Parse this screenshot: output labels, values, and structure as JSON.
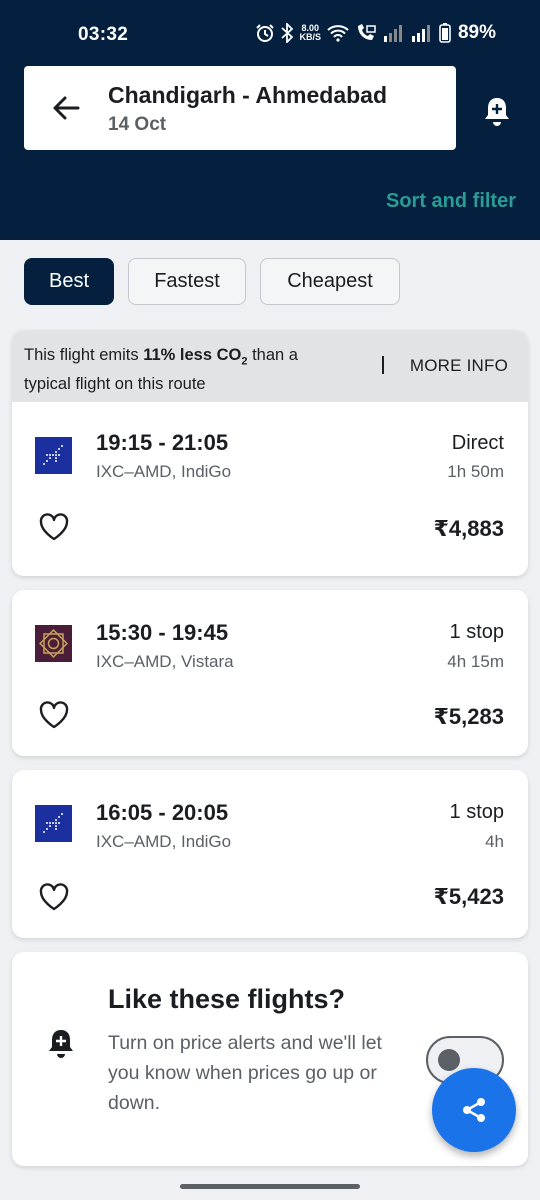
{
  "status_bar": {
    "time": "03:32",
    "speed_value": "8.00",
    "speed_unit": "KB/S",
    "battery": "89%"
  },
  "header": {
    "route": "Chandigarh - Ahmedabad",
    "date": "14 Oct",
    "sort_filter_label": "Sort and filter",
    "accent_color": "#2b9b96",
    "background_color": "#04203e"
  },
  "tabs": [
    {
      "label": "Best",
      "active": true
    },
    {
      "label": "Fastest",
      "active": false
    },
    {
      "label": "Cheapest",
      "active": false
    }
  ],
  "eco_banner": {
    "text_prefix": "This flight emits ",
    "text_bold": "11% less CO",
    "text_sub": "2",
    "text_suffix": " than a typical flight on this route",
    "more_info": "MORE INFO"
  },
  "flights": [
    {
      "times": "19:15 - 21:05",
      "route_airline": "IXC–AMD, IndiGo",
      "stops": "Direct",
      "duration": "1h 50m",
      "price": "₹4,883",
      "logo": "indigo-logo-icon"
    },
    {
      "times": "15:30 - 19:45",
      "route_airline": "IXC–AMD, Vistara",
      "stops": "1 stop",
      "duration": "4h 15m",
      "price": "₹5,283",
      "logo": "vistara-logo-icon"
    },
    {
      "times": "16:05 - 20:05",
      "route_airline": "IXC–AMD, IndiGo",
      "stops": "1 stop",
      "duration": "4h",
      "price": "₹5,423",
      "logo": "indigo-logo-icon"
    }
  ],
  "price_alert": {
    "title": "Like these flights?",
    "text": "Turn on price alerts and we'll let you know when prices go up or down.",
    "toggle_on": false
  },
  "fab": {
    "icon": "share-icon",
    "color": "#1a73e8"
  }
}
